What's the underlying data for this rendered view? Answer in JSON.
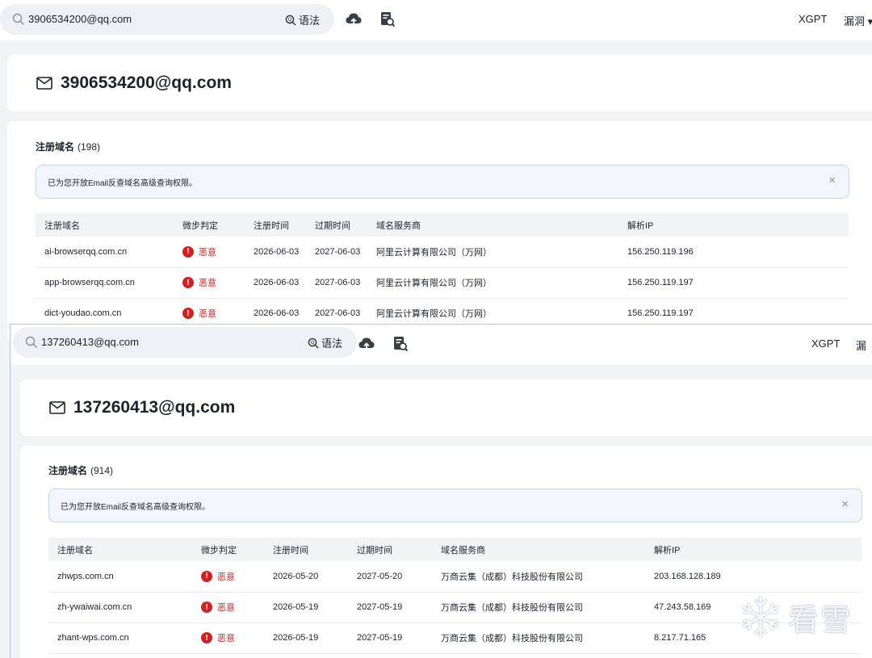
{
  "screenshots": [
    {
      "search": {
        "value": "3906534200@qq.com",
        "syntax_label": "语法"
      },
      "nav": {
        "xgpt": "XGPT",
        "vuln": "漏洞 ▾"
      },
      "email": "3906534200@qq.com",
      "section": {
        "title": "注册域名",
        "count": "(198)"
      },
      "notice": {
        "text": "已为您开放Email反查域名高级查询权限。",
        "close": "×"
      },
      "table": {
        "headers": [
          "注册域名",
          "微步判定",
          "注册时间",
          "过期时间",
          "域名服务商",
          "解析IP"
        ],
        "rows": [
          {
            "domain": "ai-browserqq.com.cn",
            "verdict": "恶意",
            "reg": "2026-06-03",
            "exp": "2027-06-03",
            "registrar": "阿里云计算有限公司（万网）",
            "ip": "156.250.119.196"
          },
          {
            "domain": "app-browserqq.com.cn",
            "verdict": "恶意",
            "reg": "2026-06-03",
            "exp": "2027-06-03",
            "registrar": "阿里云计算有限公司（万网）",
            "ip": "156.250.119.197"
          },
          {
            "domain": "dict-youdao.com.cn",
            "verdict": "恶意",
            "reg": "2026-06-03",
            "exp": "2027-06-03",
            "registrar": "阿里云计算有限公司（万网）",
            "ip": "156.250.119.197"
          }
        ]
      }
    },
    {
      "search": {
        "value": "137260413@qq.com",
        "syntax_label": "语法"
      },
      "nav": {
        "xgpt": "XGPT",
        "vuln": "漏"
      },
      "email": "137260413@qq.com",
      "section": {
        "title": "注册域名",
        "count": "(914)"
      },
      "notice": {
        "text": "已为您开放Email反查域名高级查询权限。",
        "close": "×"
      },
      "table": {
        "headers": [
          "注册域名",
          "微步判定",
          "注册时间",
          "过期时间",
          "域名服务商",
          "解析IP"
        ],
        "rows": [
          {
            "domain": "zhwps.com.cn",
            "verdict": "恶意",
            "reg": "2026-05-20",
            "exp": "2027-05-20",
            "registrar": "万商云集（成都）科技股份有限公司",
            "ip": "203.168.128.189"
          },
          {
            "domain": "zh-ywaiwai.com.cn",
            "verdict": "恶意",
            "reg": "2026-05-19",
            "exp": "2027-05-19",
            "registrar": "万商云集（成都）科技股份有限公司",
            "ip": "47.243.58.169"
          },
          {
            "domain": "zhant-wps.com.cn",
            "verdict": "恶意",
            "reg": "2026-05-19",
            "exp": "2027-05-19",
            "registrar": "万商云集（成都）科技股份有限公司",
            "ip": "8.217.71.165"
          }
        ]
      }
    }
  ],
  "watermark": {
    "text": "看雪",
    "icon": "snowflake-icon"
  },
  "colors": {
    "malicious": "#d42020",
    "accent_border": "#a9c7ee",
    "notice_bg": "#f2f6fc"
  }
}
